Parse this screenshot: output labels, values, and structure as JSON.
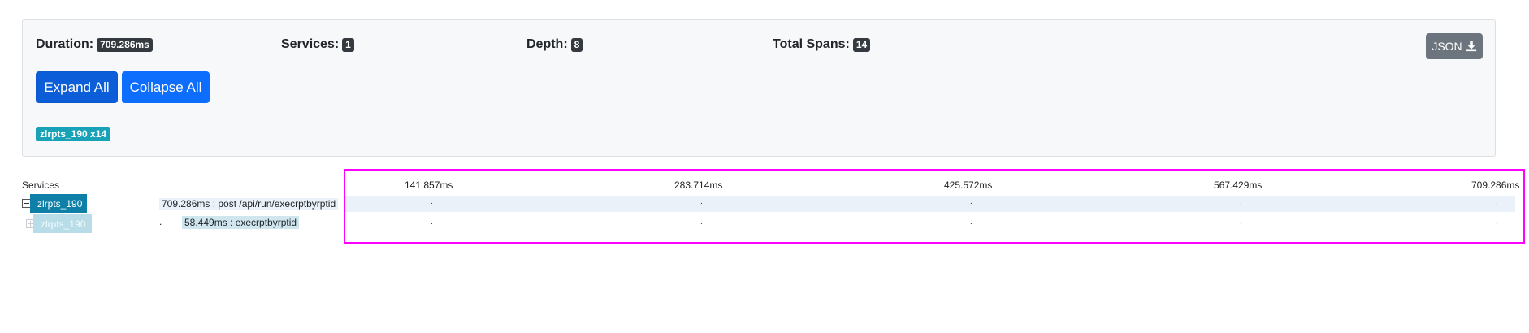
{
  "summary": {
    "duration_label": "Duration:",
    "duration_value": "709.286ms",
    "services_label": "Services:",
    "services_value": "1",
    "depth_label": "Depth:",
    "depth_value": "8",
    "total_spans_label": "Total Spans:",
    "total_spans_value": "14",
    "json_button": "JSON",
    "expand_all": "Expand All",
    "collapse_all": "Collapse All",
    "service_tag": "zlrpts_190 x14"
  },
  "timeline": {
    "services_header": "Services",
    "ticks": [
      "141.857ms",
      "283.714ms",
      "425.572ms",
      "567.429ms",
      "709.286ms"
    ]
  },
  "rows": [
    {
      "service": "zlrpts_190",
      "span": "709.286ms : post /api/run/execrptbyrptid",
      "expanded": true
    },
    {
      "service": "zlrpts_190",
      "span": "58.449ms : execrptbyrptid",
      "expanded": false
    }
  ],
  "colors": {
    "primary": "#0d6efd",
    "service_main": "#0e7fa6",
    "service_tag": "#17a2b8",
    "highlight": "#ff00ff"
  }
}
